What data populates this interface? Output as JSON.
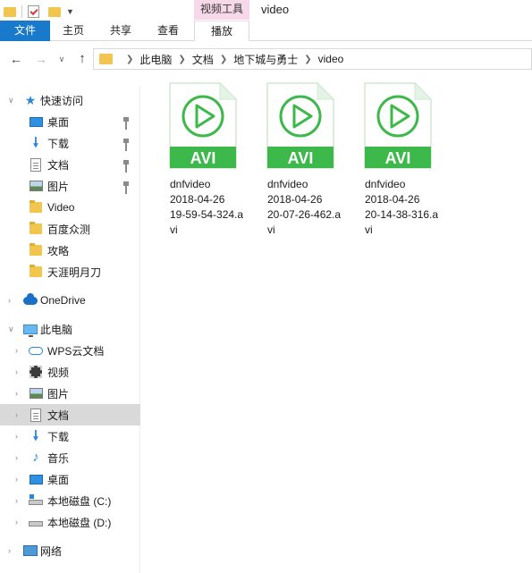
{
  "window": {
    "title": "video",
    "context_tab_group": "视频工具"
  },
  "ribbon": {
    "tabs": [
      {
        "label": "文件",
        "active": true
      },
      {
        "label": "主页"
      },
      {
        "label": "共享"
      },
      {
        "label": "查看"
      },
      {
        "label": "播放"
      }
    ]
  },
  "address_bar": {
    "breadcrumb": [
      "此电脑",
      "文档",
      "地下城与勇士",
      "video"
    ]
  },
  "sidebar": {
    "quick_access": {
      "label": "快速访问",
      "items": [
        {
          "label": "桌面",
          "icon": "desktop-icon",
          "pinned": true
        },
        {
          "label": "下载",
          "icon": "download-icon",
          "pinned": true
        },
        {
          "label": "文档",
          "icon": "document-icon",
          "pinned": true
        },
        {
          "label": "图片",
          "icon": "pictures-icon",
          "pinned": true
        },
        {
          "label": "Video",
          "icon": "folder-icon"
        },
        {
          "label": "百度众测",
          "icon": "folder-icon"
        },
        {
          "label": "攻略",
          "icon": "folder-icon"
        },
        {
          "label": "天涯明月刀",
          "icon": "folder-icon"
        }
      ]
    },
    "onedrive": {
      "label": "OneDrive"
    },
    "this_pc": {
      "label": "此电脑",
      "items": [
        {
          "label": "WPS云文档",
          "icon": "cloud-icon"
        },
        {
          "label": "视频",
          "icon": "video-folder-icon"
        },
        {
          "label": "图片",
          "icon": "pictures-icon"
        },
        {
          "label": "文档",
          "icon": "document-icon",
          "selected": true
        },
        {
          "label": "下载",
          "icon": "download-icon"
        },
        {
          "label": "音乐",
          "icon": "music-icon"
        },
        {
          "label": "桌面",
          "icon": "desktop-icon"
        },
        {
          "label": "本地磁盘 (C:)",
          "icon": "drive-icon"
        },
        {
          "label": "本地磁盘 (D:)",
          "icon": "drive-icon"
        }
      ]
    },
    "network": {
      "label": "网络"
    }
  },
  "files": [
    {
      "line1": "dnfvideo",
      "line2": "2018-04-26",
      "line3": "19-59-54-324.a",
      "line4": "vi",
      "type_badge": "AVI"
    },
    {
      "line1": "dnfvideo",
      "line2": "2018-04-26",
      "line3": "20-07-26-462.a",
      "line4": "vi",
      "type_badge": "AVI"
    },
    {
      "line1": "dnfvideo",
      "line2": "2018-04-26",
      "line3": "20-14-38-316.a",
      "line4": "vi",
      "type_badge": "AVI"
    }
  ],
  "colors": {
    "file_tab": "#1979ca",
    "context_tab": "#f7d8e8",
    "avi_green": "#3cb94a",
    "selected_row": "#d9d9d9",
    "folder_yellow": "#f2c64e"
  }
}
